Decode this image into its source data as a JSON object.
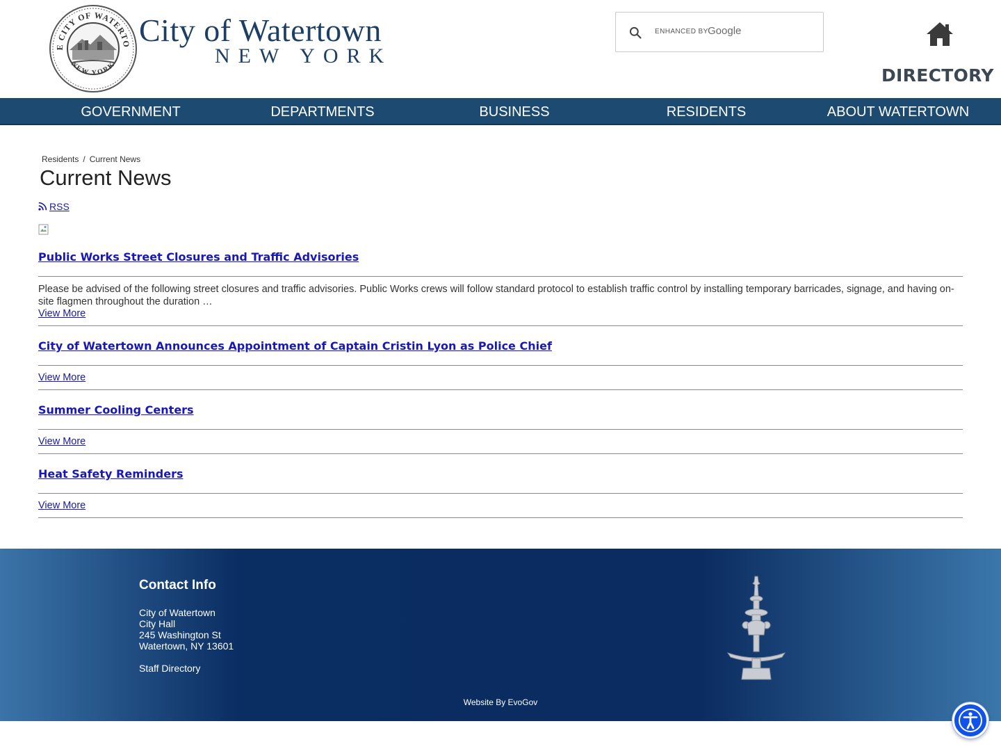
{
  "header": {
    "seal": {
      "icon": "city-seal-icon",
      "text_top": "THE CITY OF WATERTOWN",
      "text_bottom": "NEW YORK"
    },
    "title": "City of Watertown",
    "subtitle": "NEW YORK",
    "search": {
      "enhanced_label": "ENHANCED BY",
      "google_label": "Google",
      "value": ""
    },
    "home_icon": "home-icon",
    "directory_label": "DIRECTORY"
  },
  "nav": {
    "items": [
      {
        "label": "GOVERNMENT"
      },
      {
        "label": "DEPARTMENTS"
      },
      {
        "label": "BUSINESS"
      },
      {
        "label": "RESIDENTS"
      },
      {
        "label": "ABOUT WATERTOWN"
      }
    ]
  },
  "breadcrumb": {
    "items": [
      "Residents",
      "Current News"
    ],
    "separator": "/"
  },
  "page_title": "Current News",
  "rss_label": "RSS",
  "news": [
    {
      "title": "Public Works Street Closures and Traffic Advisories",
      "body": "Please be advised of the following street closures and traffic advisories. Public Works crews will follow standard protocol to establish traffic control by installing temporary barricades, signage, and having on-site flagmen throughout the duration …",
      "view_more": "View More"
    },
    {
      "title": "City of Watertown Announces Appointment of Captain Cristin Lyon as Police Chief",
      "body": "",
      "view_more": "View More"
    },
    {
      "title": "Summer Cooling Centers",
      "body": "",
      "view_more": "View More"
    },
    {
      "title": "Heat Safety Reminders",
      "body": "",
      "view_more": "View More"
    }
  ],
  "footer": {
    "heading": "Contact Info",
    "lines": [
      "City of Watertown",
      "City Hall",
      "245 Washington St",
      "Watertown, NY 13601"
    ],
    "staff_directory": "Staff Directory",
    "credit": "Website By EvoGov",
    "fountain_icon": "fountain-icon"
  },
  "accessibility_icon": "accessibility-icon",
  "colors": {
    "nav_bg": "#1c4a70",
    "title_blue": "#1d3f66",
    "link_blue": "#1818b8",
    "footer_dark": "#0a2d62",
    "footer_light": "#3b74a8",
    "a11y_blue": "#1153e8"
  }
}
